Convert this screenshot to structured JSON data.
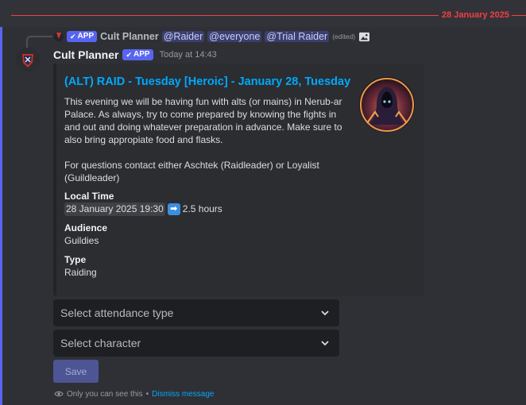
{
  "divider": {
    "date": "28 January 2025"
  },
  "reply": {
    "app_tag": "APP",
    "author": "Cult Planner",
    "mentions": [
      "@Raider",
      "@everyone",
      "@Trial Raider"
    ],
    "edited": "(edited)",
    "attachment_icon": "image-icon"
  },
  "message": {
    "author": "Cult Planner",
    "app_tag": "APP",
    "timestamp": "Today at 14:43"
  },
  "embed": {
    "title": "(ALT) RAID - Tuesday [Heroic] - January 28, Tuesday",
    "description_p1": "This evening we will be having fun with alts (or mains) in Nerub-ar Palace. As always, try to come prepared by knowing the fights in and out and doing whatever preparation in advance. Make sure to also bring appropiate food and flasks.",
    "description_p2": "For questions contact either Aschtek (Raidleader) or Loyalist (Guildleader)",
    "fields": [
      {
        "name": "Local Time",
        "time": "28 January 2025 19:30",
        "arrow": "➡",
        "duration": "2.5 hours"
      },
      {
        "name": "Audience",
        "value": "Guildies"
      },
      {
        "name": "Type",
        "value": "Raiding"
      }
    ]
  },
  "components": {
    "select_attendance_placeholder": "Select attendance type",
    "select_character_placeholder": "Select character",
    "save_label": "Save"
  },
  "ephemeral": {
    "icon": "eye-icon",
    "text": "Only you can see this",
    "separator": "•",
    "dismiss": "Dismiss message"
  },
  "colors": {
    "accent": "#5865f2",
    "link": "#00a8fc",
    "divider_red": "#f23f43"
  }
}
